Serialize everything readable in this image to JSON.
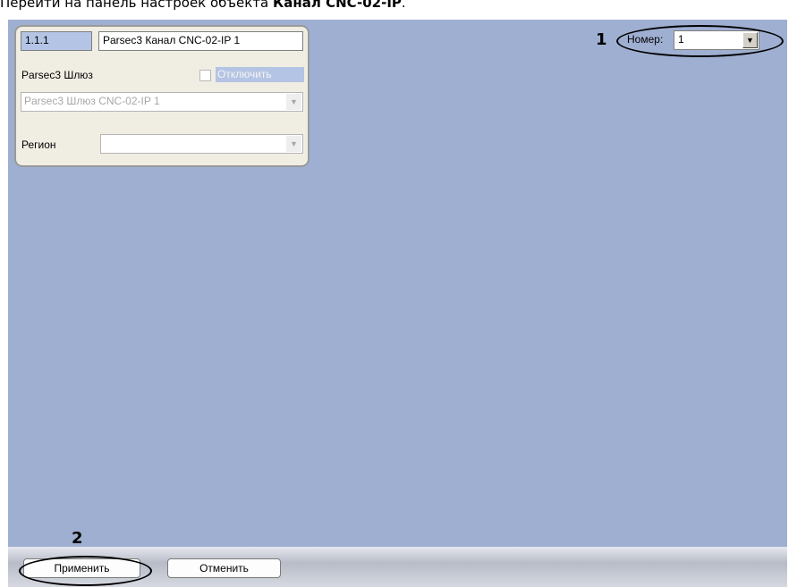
{
  "caption": {
    "text_prefix": "Перейти на панель настроек объекта ",
    "text_bold": "Канал CNC-02-IP",
    "text_suffix": "."
  },
  "panel": {
    "id_value": "1.1.1",
    "name_value": "Parsec3 Канал CNC-02-IP 1",
    "gateway_label": "Parsec3 Шлюз",
    "disable_label": "Отключить",
    "gateway_value": "Parsec3 Шлюз CNC-02-IP 1",
    "region_label": "Регион",
    "region_value": ""
  },
  "number": {
    "label": "Номер:",
    "value": "1"
  },
  "markers": {
    "one": "1",
    "two": "2"
  },
  "buttons": {
    "apply": "Применить",
    "cancel": "Отменить"
  }
}
